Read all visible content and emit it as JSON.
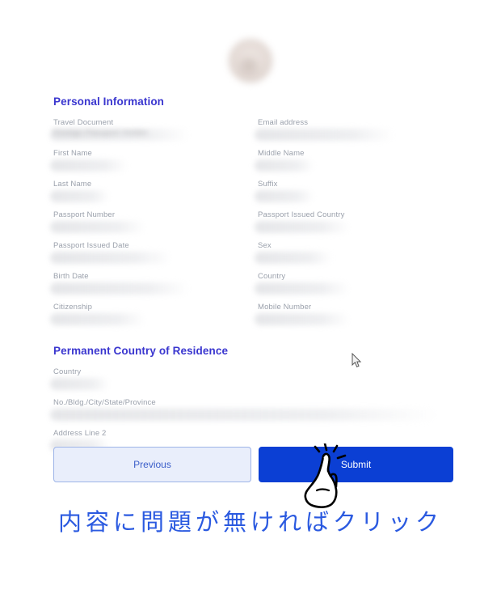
{
  "avatar": {
    "alt": "profile-photo"
  },
  "sections": [
    {
      "title": "Personal Information",
      "fields_left": [
        {
          "label": "Travel Document",
          "value": "Foreign Passport Holder",
          "smudge": "sm-xl"
        },
        {
          "label": "First Name",
          "value": "",
          "smudge": "sm-s"
        },
        {
          "label": "Last Name",
          "value": "",
          "smudge": "sm-xs"
        },
        {
          "label": "Passport Number",
          "value": "",
          "smudge": "sm-m"
        },
        {
          "label": "Passport Issued Date",
          "value": "",
          "smudge": "sm-l"
        },
        {
          "label": "Birth Date",
          "value": "",
          "smudge": "sm-xl"
        },
        {
          "label": "Citizenship",
          "value": "",
          "smudge": "sm-m"
        }
      ],
      "fields_right": [
        {
          "label": "Email address",
          "value": "",
          "smudge": "sm-xl"
        },
        {
          "label": "Middle Name",
          "value": "",
          "smudge": "sm-xs"
        },
        {
          "label": "Suffix",
          "value": "",
          "smudge": "sm-xs"
        },
        {
          "label": "Passport Issued Country",
          "value": "",
          "smudge": "sm-m"
        },
        {
          "label": "Sex",
          "value": "",
          "smudge": "sm-s"
        },
        {
          "label": "Country",
          "value": "",
          "smudge": "sm-m"
        },
        {
          "label": "Mobile Number",
          "value": "",
          "smudge": "sm-m"
        }
      ]
    },
    {
      "title": "Permanent Country of Residence",
      "fields_left": [
        {
          "label": "Country",
          "value": "",
          "smudge": "sm-xs"
        },
        {
          "label": "No./Bldg./City/State/Province",
          "value": "",
          "smudge": "sm-full"
        },
        {
          "label": "Address Line 2",
          "value": "",
          "smudge": "sm-xs"
        }
      ],
      "fields_right": []
    }
  ],
  "actions": {
    "previous_label": "Previous",
    "submit_label": "Submit"
  },
  "annotation": {
    "text": "内容に問題が無ければクリック"
  },
  "colors": {
    "heading": "#3a36cf",
    "submit_bg": "#0b3fd4",
    "previous_bg": "#e9eefb",
    "previous_border": "#9db4e8",
    "previous_text": "#3b5ec9",
    "annotation": "#2b5ae0",
    "label": "#9aa0ab"
  },
  "icons": {
    "hand_pointer": "pointing-hand-click-icon",
    "mouse_cursor": "arrow-cursor-icon"
  }
}
